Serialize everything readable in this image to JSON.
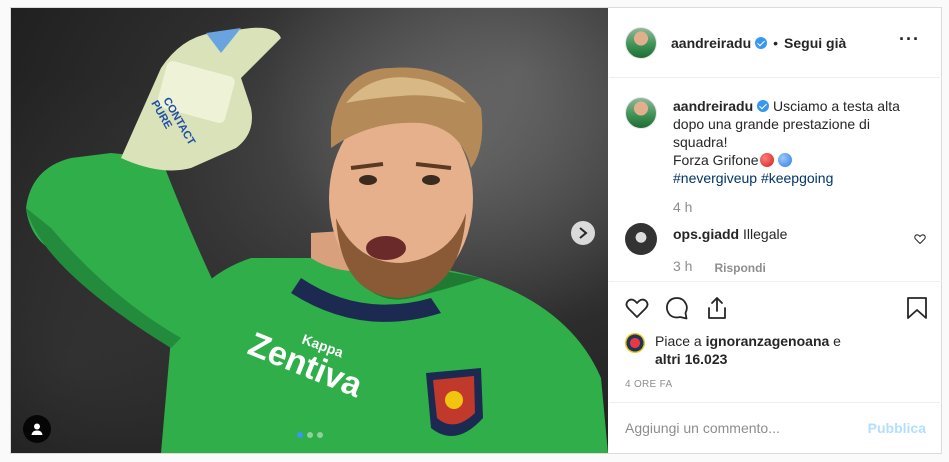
{
  "post": {
    "author": "aandreiradu",
    "follow_separator": "•",
    "follow_label": "Segui già",
    "more_label": "···",
    "caption_lines": [
      "Usciamo a testa alta",
      "dopo una grande prestazione di",
      "squadra!",
      "Forza Grifone"
    ],
    "caption_emojis": [
      "red-circle",
      "blue-circle"
    ],
    "hashtags": "#nevergiveup #keepgoing",
    "caption_time": "4 h",
    "carousel": {
      "total": 3,
      "current": 1
    },
    "comments": [
      {
        "user": "ops.giadd",
        "text": "Illegale",
        "time": "3 h",
        "reply_label": "Rispondi"
      }
    ],
    "likes": {
      "prefix": "Piace a",
      "user": "ignoranzagenoana",
      "connector": "e",
      "others": "altri 16.023"
    },
    "posted_ago": "4 ORE FA",
    "add_comment": {
      "placeholder": "Aggiungi un commento...",
      "publish_label": "Pubblica"
    }
  },
  "photo": {
    "glove_text": [
      "PURE",
      "CONTACT"
    ],
    "sponsor": "Zentiva",
    "kit_brand": "Kappa"
  },
  "icons": {
    "verified": "verified-badge-icon",
    "more": "more-options-icon",
    "like": "heart-icon",
    "comment": "comment-icon",
    "share": "share-icon",
    "save": "bookmark-icon",
    "next": "chevron-right-icon",
    "tag": "user-tag-icon"
  },
  "colors": {
    "accent": "#3897f0",
    "hashtag": "#003569",
    "muted": "#8e8e8e",
    "publish_disabled": "#b2dffc",
    "jersey": "#2fae4a"
  }
}
